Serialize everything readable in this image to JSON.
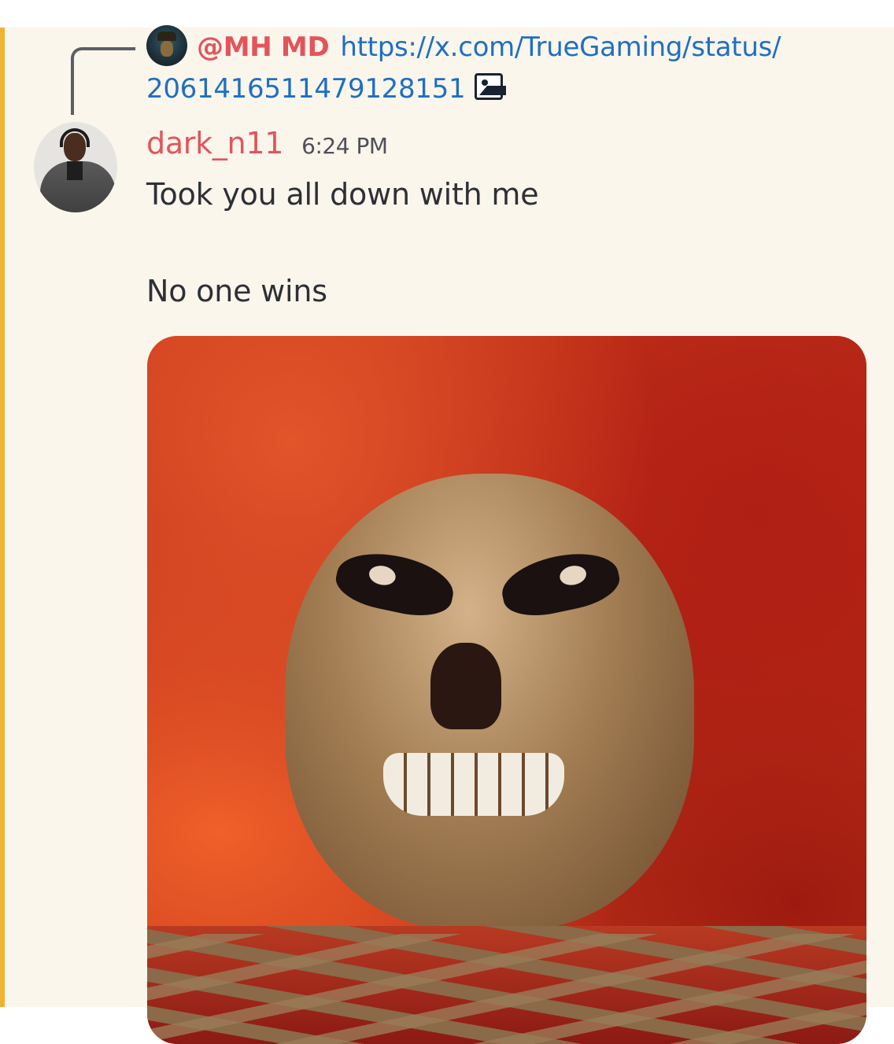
{
  "reply": {
    "author": "@MH MD",
    "link_line1": "https://x.com/TrueGaming/status/",
    "link_line2": "2061416511479128151",
    "attachment_icon": "image-icon"
  },
  "message": {
    "username": "dark_n11",
    "timestamp": "6:24 PM",
    "lines": [
      "Took you all down with me",
      "No one wins"
    ],
    "attachment": "skeleton-image"
  },
  "colors": {
    "background": "#fbf6ec",
    "mention_bar": "#f0b232",
    "username": "#e3545b",
    "link": "#1f6fc2",
    "text": "#2e3036"
  }
}
